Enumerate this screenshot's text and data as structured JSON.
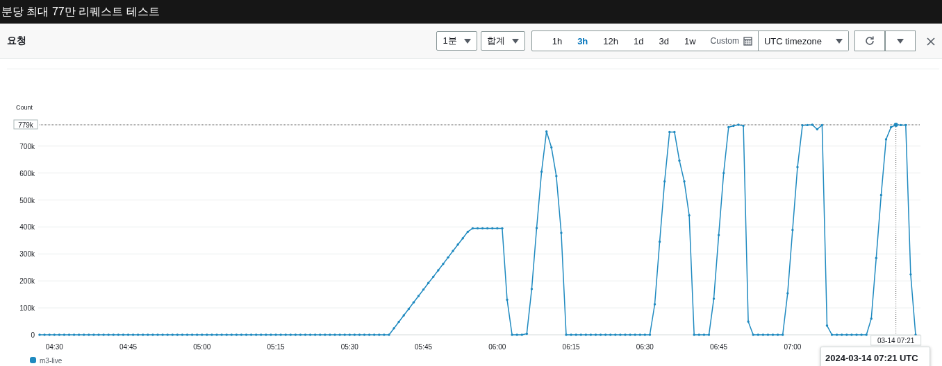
{
  "title": "분당 최대 77만 리퀘스트 테스트",
  "panel": {
    "title": "요청",
    "period": {
      "value": "1분"
    },
    "statistic": {
      "value": "합계"
    },
    "ranges": [
      {
        "label": "1h",
        "selected": false
      },
      {
        "label": "3h",
        "selected": true
      },
      {
        "label": "12h",
        "selected": false
      },
      {
        "label": "1d",
        "selected": false
      },
      {
        "label": "3d",
        "selected": false
      },
      {
        "label": "1w",
        "selected": false
      }
    ],
    "custom": {
      "label": "Custom"
    },
    "timezone": {
      "value": "UTC timezone"
    },
    "chart": {
      "chart_data": {
        "type": "line",
        "ylabel": "Count",
        "categories": [
          null,
          null,
          null,
          "04:30",
          null,
          null,
          null,
          null,
          null,
          null,
          null,
          null,
          null,
          null,
          null,
          null,
          null,
          null,
          "04:45",
          null,
          null,
          null,
          null,
          null,
          null,
          null,
          null,
          null,
          null,
          null,
          null,
          null,
          null,
          "05:00",
          null,
          null,
          null,
          null,
          null,
          null,
          null,
          null,
          null,
          null,
          null,
          null,
          null,
          null,
          "05:15",
          null,
          null,
          null,
          null,
          null,
          null,
          null,
          null,
          null,
          null,
          null,
          null,
          null,
          null,
          "05:30",
          null,
          null,
          null,
          null,
          null,
          null,
          null,
          null,
          null,
          null,
          null,
          null,
          null,
          null,
          "05:45",
          null,
          null,
          null,
          null,
          null,
          null,
          null,
          null,
          null,
          null,
          null,
          null,
          null,
          null,
          "06:00",
          null,
          null,
          null,
          null,
          null,
          null,
          null,
          null,
          null,
          null,
          null,
          null,
          null,
          null,
          "06:15",
          null,
          null,
          null,
          null,
          null,
          null,
          null,
          null,
          null,
          null,
          null,
          null,
          null,
          null,
          "06:30",
          null,
          null,
          null,
          null,
          null,
          null,
          null,
          null,
          null,
          null,
          null,
          null,
          null,
          null,
          "06:45",
          null,
          null,
          null,
          null,
          null,
          null,
          null,
          null,
          null,
          null,
          null,
          null,
          null,
          null,
          "07:00",
          null,
          null,
          null,
          null,
          null,
          null,
          null,
          null,
          null,
          null,
          null,
          null,
          null,
          null,
          null,
          null,
          null,
          null,
          null,
          null,
          null,
          null,
          null,
          null,
          null
        ],
        "series": [
          {
            "name": "m3-live",
            "color": "#1f8ac0",
            "values": [
              0,
              0,
              0,
              0,
              0,
              0,
              0,
              0,
              0,
              0,
              0,
              0,
              0,
              0,
              0,
              0,
              0,
              0,
              0,
              0,
              0,
              0,
              0,
              0,
              0,
              0,
              0,
              0,
              0,
              0,
              0,
              0,
              0,
              0,
              0,
              0,
              0,
              0,
              0,
              0,
              0,
              0,
              0,
              0,
              0,
              0,
              0,
              0,
              0,
              0,
              0,
              0,
              0,
              0,
              0,
              0,
              0,
              0,
              0,
              0,
              0,
              0,
              0,
              0,
              0,
              0,
              0,
              0,
              0,
              0,
              0,
              0,
              24000,
              48000,
              72000,
              96000,
              120000,
              144000,
              168000,
              192000,
              215000,
              239000,
              263000,
              287000,
              311000,
              335000,
              358000,
              382000,
              395000,
              395000,
              395000,
              395000,
              395000,
              395000,
              395000,
              130000,
              0,
              0,
              0,
              4000,
              170000,
              396000,
              605000,
              754000,
              695000,
              589000,
              378000,
              0,
              0,
              0,
              0,
              0,
              0,
              0,
              0,
              0,
              0,
              0,
              0,
              0,
              0,
              0,
              0,
              0,
              0,
              113000,
              345000,
              569000,
              752000,
              752000,
              646000,
              569000,
              443000,
              0,
              0,
              0,
              0,
              134000,
              370000,
              600000,
              770000,
              775000,
              779000,
              775000,
              49000,
              0,
              0,
              0,
              0,
              0,
              0,
              0,
              154000,
              389000,
              622000,
              777000,
              778000,
              779000,
              762000,
              778000,
              34000,
              0,
              0,
              0,
              0,
              0,
              0,
              0,
              0,
              60000,
              285000,
              518000,
              725000,
              770000,
              779000,
              778000,
              778000,
              224000,
              0
            ]
          }
        ],
        "ylim": [
          0,
          779000
        ],
        "yticks": [
          {
            "value": 0,
            "label": "0"
          },
          {
            "value": 100000,
            "label": "100k"
          },
          {
            "value": 200000,
            "label": "200k"
          },
          {
            "value": 300000,
            "label": "300k"
          },
          {
            "value": 400000,
            "label": "400k"
          },
          {
            "value": 500000,
            "label": "500k"
          },
          {
            "value": 600000,
            "label": "600k"
          },
          {
            "value": 700000,
            "label": "700k"
          },
          {
            "value": 779000,
            "label": "779k"
          }
        ],
        "grid": true
      },
      "crosshair": {
        "label": "03-14 07:21"
      },
      "tooltip": {
        "title": "2024-03-14 07:21 UTC"
      }
    }
  }
}
